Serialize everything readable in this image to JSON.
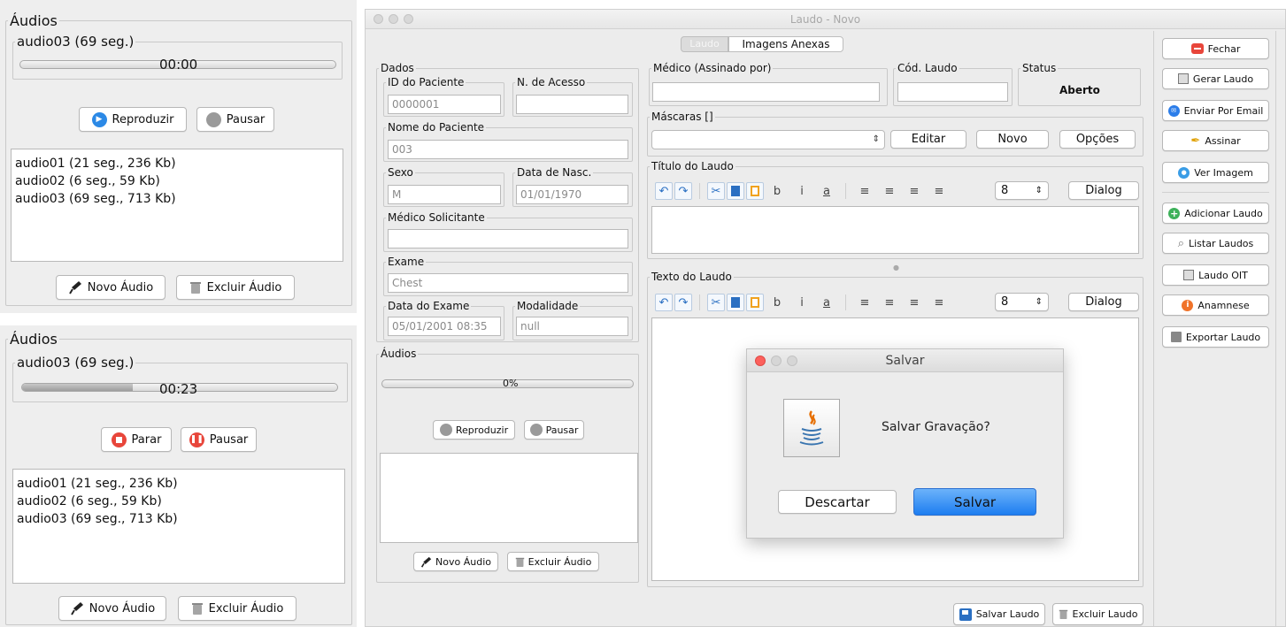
{
  "audio_panel_1": {
    "title": "Áudios",
    "current_audio": "audio03 (69 seg.)",
    "time": "00:00",
    "progress_fraction": 0,
    "play_label": "Reproduzir",
    "pause_label": "Pausar",
    "items": [
      "audio01 (21 seg., 236 Kb)",
      "audio02 (6 seg., 59 Kb)",
      "audio03 (69 seg., 713 Kb)"
    ],
    "new_label": "Novo Áudio",
    "delete_label": "Excluir Áudio"
  },
  "audio_panel_2": {
    "title": "Áudios",
    "current_audio": "audio03 (69 seg.)",
    "time": "00:23",
    "progress_fraction": 0.35,
    "stop_label": "Parar",
    "pause_label": "Pausar",
    "items": [
      "audio01 (21 seg., 236 Kb)",
      "audio02 (6 seg., 59 Kb)",
      "audio03 (69 seg., 713 Kb)"
    ],
    "new_label": "Novo Áudio",
    "delete_label": "Excluir Áudio"
  },
  "window": {
    "title": "Laudo - Novo",
    "tabs": [
      "Laudo",
      "Imagens Anexas"
    ],
    "dados": {
      "legend": "Dados",
      "id_label": "ID do Paciente",
      "id_value": "0000001",
      "acesso_label": "N. de Acesso",
      "acesso_value": "",
      "nome_label": "Nome do Paciente",
      "nome_value": "003",
      "sexo_label": "Sexo",
      "sexo_value": "M",
      "nasc_label": "Data de Nasc.",
      "nasc_value": "01/01/1970",
      "medico_label": "Médico Solicitante",
      "medico_value": "",
      "exame_label": "Exame",
      "exame_value": "Chest",
      "data_exame_label": "Data do Exame",
      "data_exame_value": "05/01/2001 08:35",
      "modalidade_label": "Modalidade",
      "modalidade_value": "null"
    },
    "audios": {
      "legend": "Áudios",
      "progress_text": "0%",
      "play_label": "Reproduzir",
      "pause_label": "Pausar",
      "new_label": "Novo Áudio",
      "delete_label": "Excluir Áudio"
    },
    "medico_assinado_label": "Médico (Assinado por)",
    "cod_laudo_label": "Cód. Laudo",
    "status_label": "Status",
    "status_value": "Aberto",
    "mascaras_label": "Máscaras []",
    "editar_label": "Editar",
    "novo_label": "Novo",
    "opcoes_label": "Opções",
    "titulo_laudo_label": "Título do Laudo",
    "texto_laudo_label": "Texto do Laudo",
    "toolbar": {
      "b": "b",
      "i": "i",
      "a": "a",
      "font_size": "8",
      "font_name": "Dialog"
    },
    "salvar_laudo_label": "Salvar Laudo",
    "excluir_laudo_label": "Excluir Laudo",
    "side_buttons": [
      "Fechar",
      "Gerar Laudo",
      "Enviar Por Email",
      "Assinar",
      "Ver Imagem",
      "Adicionar Laudo",
      "Listar Laudos",
      "Laudo OIT",
      "Anamnese",
      "Exportar Laudo"
    ]
  },
  "dialog": {
    "title": "Salvar",
    "message": "Salvar Gravação?",
    "discard_label": "Descartar",
    "save_label": "Salvar"
  },
  "colors": {
    "accent_blue": "#2b7de9",
    "red": "#e8463b",
    "orange": "#f0732a",
    "green": "#3db15a"
  }
}
